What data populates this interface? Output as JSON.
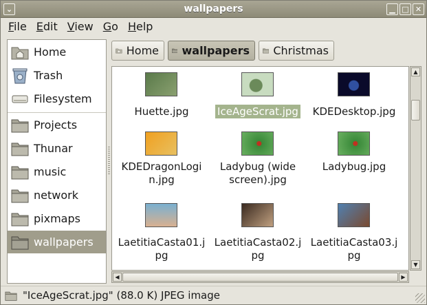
{
  "window": {
    "title": "wallpapers"
  },
  "menubar": {
    "items": [
      {
        "first": "F",
        "rest": "ile"
      },
      {
        "first": "E",
        "rest": "dit"
      },
      {
        "first": "V",
        "rest": "iew"
      },
      {
        "first": "G",
        "rest": "o"
      },
      {
        "first": "H",
        "rest": "elp"
      }
    ]
  },
  "sidebar": {
    "items": [
      {
        "label": "Home",
        "icon": "home-folder-icon"
      },
      {
        "label": "Trash",
        "icon": "trash-icon"
      },
      {
        "label": "Filesystem",
        "icon": "drive-icon"
      },
      {
        "label": "Projects",
        "icon": "folder-icon"
      },
      {
        "label": "Thunar",
        "icon": "folder-icon"
      },
      {
        "label": "music",
        "icon": "folder-icon"
      },
      {
        "label": "network",
        "icon": "folder-icon"
      },
      {
        "label": "pixmaps",
        "icon": "folder-icon"
      },
      {
        "label": "wallpapers",
        "icon": "folder-icon",
        "selected": true
      }
    ]
  },
  "pathbar": {
    "buttons": [
      {
        "label": "Home",
        "icon": "home-folder-icon"
      },
      {
        "label": "wallpapers",
        "icon": "folder-icon",
        "active": true
      },
      {
        "label": "Christmas",
        "icon": "folder-icon"
      }
    ]
  },
  "files": [
    {
      "line1": "Huette.jpg",
      "line2": "",
      "colors": [
        "#5a7a4a",
        "#8aa070"
      ]
    },
    {
      "line1": "IceAgeScrat.jpg",
      "line2": "",
      "selected": true,
      "colors": [
        "#c8dcc0",
        "#6b8a5a"
      ]
    },
    {
      "line1": "KDEDesktop.jpg",
      "line2": "",
      "colors": [
        "#0a0a2a",
        "#3050a0"
      ]
    },
    {
      "line1": "KDEDragonLogi",
      "line2": "n.jpg",
      "colors": [
        "#f0a020",
        "#e8c060"
      ]
    },
    {
      "line1": "Ladybug (wide",
      "line2": "screen).jpg",
      "colors": [
        "#3a8a3a",
        "#6ab060"
      ]
    },
    {
      "line1": "Ladybug.jpg",
      "line2": "",
      "colors": [
        "#3a8a3a",
        "#6ab060"
      ]
    },
    {
      "line1": "LaetitiaCasta01.j",
      "line2": "pg",
      "colors": [
        "#7ab0d0",
        "#d8b090"
      ]
    },
    {
      "line1": "LaetitiaCasta02.j",
      "line2": "pg",
      "colors": [
        "#3a2a20",
        "#c0a080"
      ]
    },
    {
      "line1": "LaetitiaCasta03.j",
      "line2": "pg",
      "colors": [
        "#5080b0",
        "#7a4a30"
      ]
    }
  ],
  "statusbar": {
    "text": "\"IceAgeScrat.jpg\" (88.0 K) JPEG image"
  },
  "colors": {
    "selection": "#a4b48d",
    "sidebar_selected": "#a09d8b",
    "titlebar": "#8d8a77"
  }
}
